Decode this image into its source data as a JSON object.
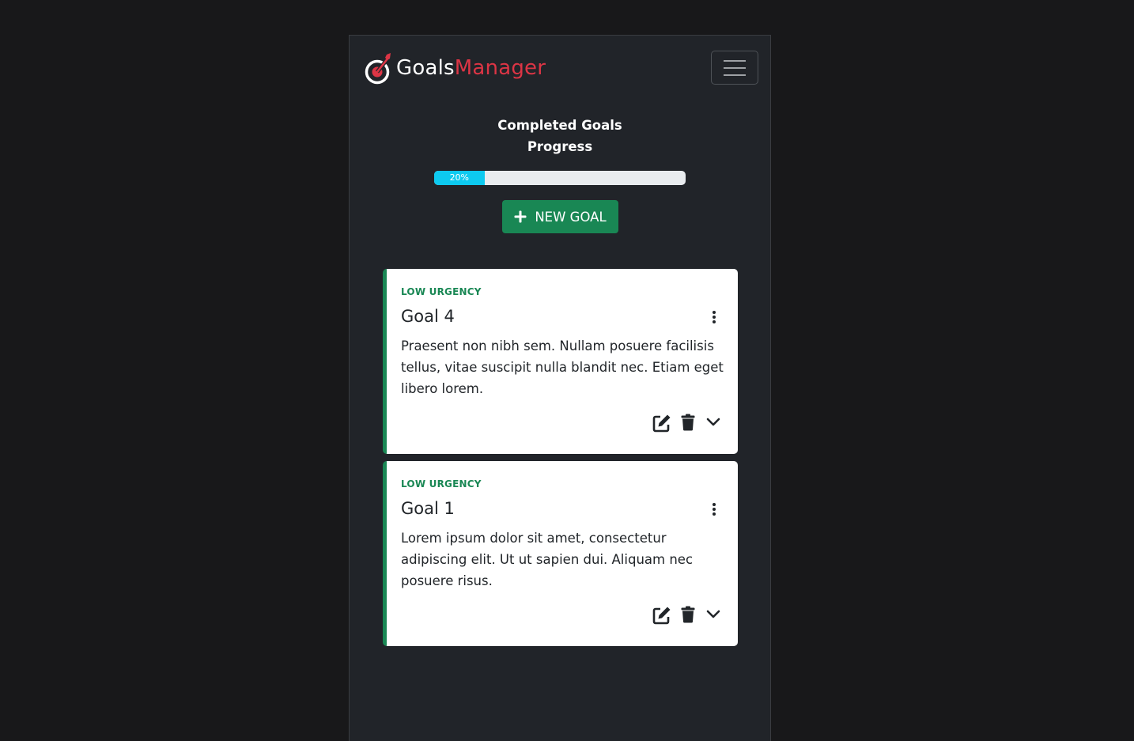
{
  "brand": {
    "part1": "Goals",
    "part2": "Manager",
    "colors": {
      "primary": "#ffffff",
      "accent": "#dc3545"
    },
    "icon": "target-arrow-icon"
  },
  "navbar": {
    "toggle_icon": "hamburger-menu-icon"
  },
  "progress": {
    "title_line1": "Completed Goals",
    "title_line2": "Progress",
    "percent_value": 20,
    "percent_label": "20%",
    "color": "#0dcaf0"
  },
  "new_goal_button": {
    "label": "NEW GOAL",
    "icon": "plus-icon",
    "color": "#198754"
  },
  "goals": [
    {
      "urgency": "LOW URGENCY",
      "title": "Goal 4",
      "description": "Praesent non nibh sem. Nullam posuere facilisis tellus, vitae suscipit nulla blandit nec. Etiam eget libero lorem.",
      "urgency_color": "#198754"
    },
    {
      "urgency": "LOW URGENCY",
      "title": "Goal 1",
      "description": "Lorem ipsum dolor sit amet, consectetur adipiscing elit. Ut ut sapien dui. Aliquam nec posuere risus.",
      "urgency_color": "#198754"
    }
  ],
  "card_actions": {
    "menu_icon": "kebab-menu-icon",
    "edit_icon": "edit-icon",
    "delete_icon": "trash-icon",
    "expand_icon": "chevron-down-icon"
  }
}
